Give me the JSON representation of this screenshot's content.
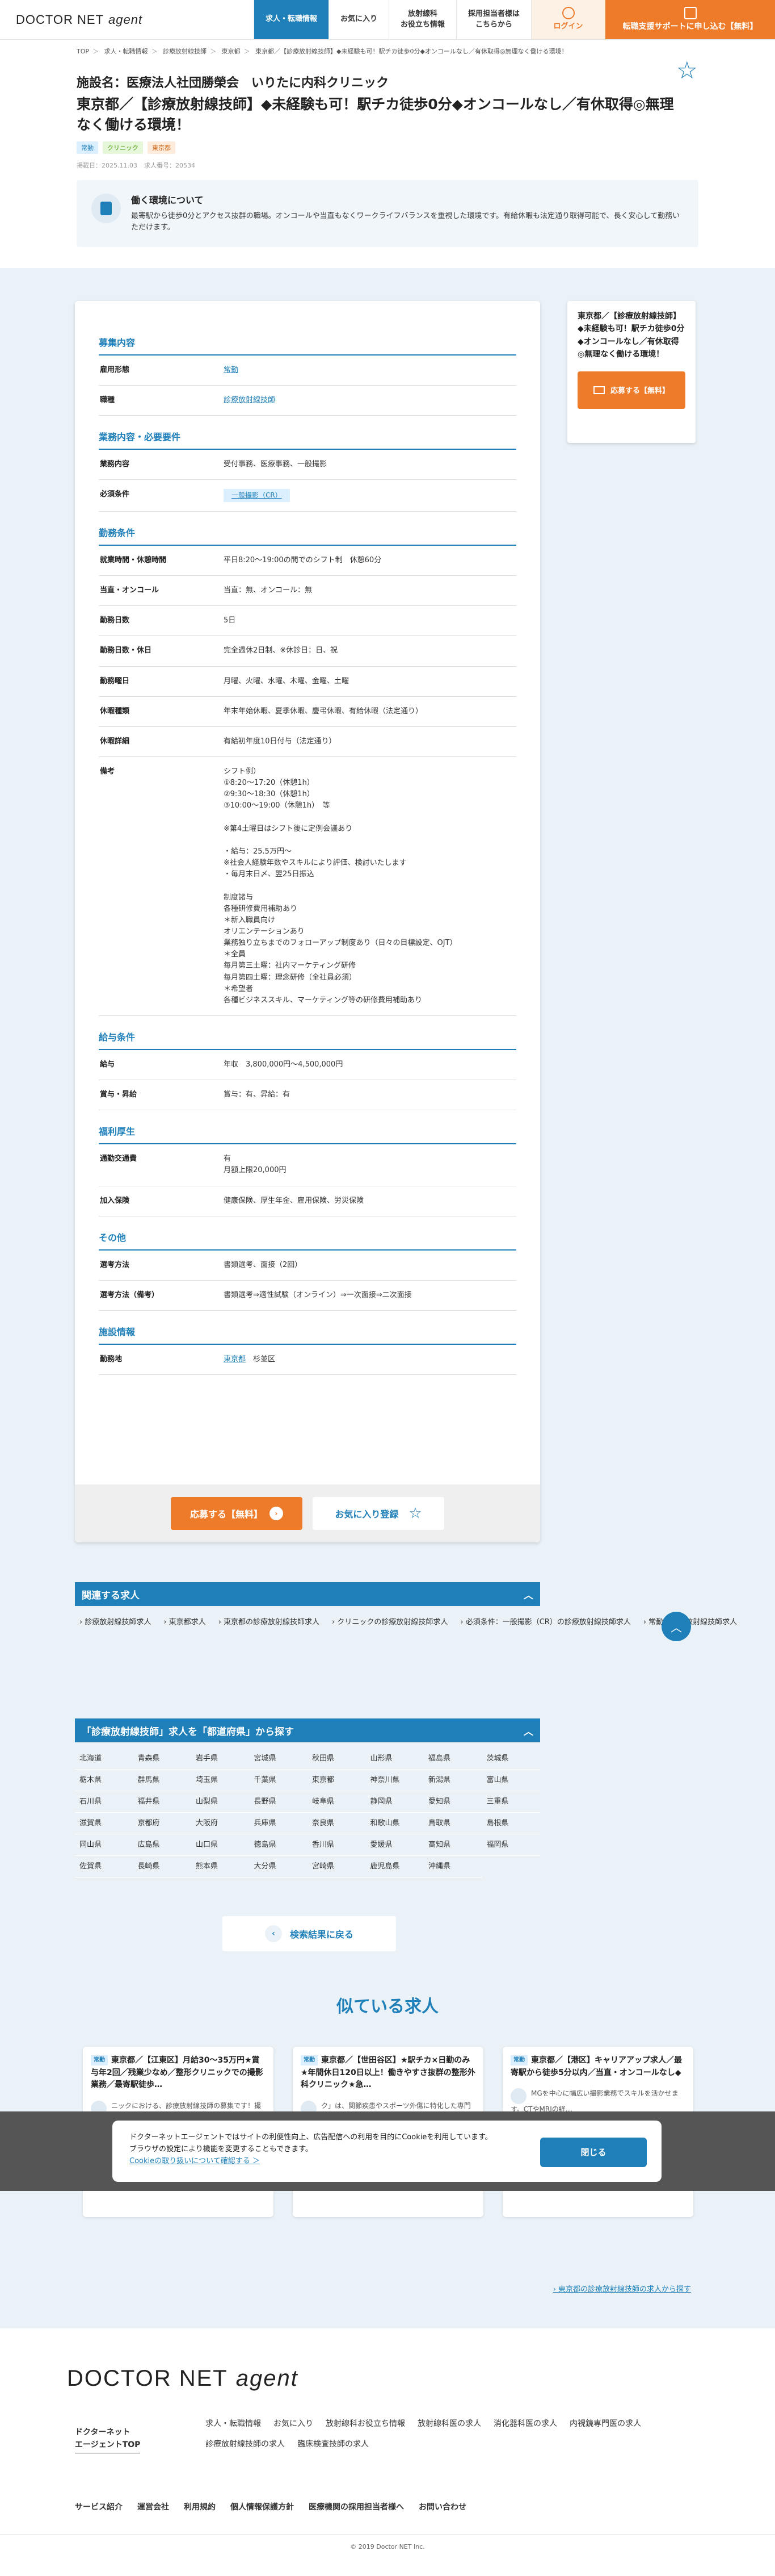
{
  "header": {
    "logo_main": "DOCTOR NET",
    "logo_sub": "agent",
    "nav": [
      "求人・転職情報",
      "お気に入り",
      "放射線科\nお役立ち情報",
      "採用担当者様は\nこちらから"
    ],
    "login": "ログイン",
    "cta": "転職支援サポートに申し込む【無料】"
  },
  "breadcrumb": [
    "TOP",
    "求人・転職情報",
    "診療放射線技師",
    "東京都",
    "東京都／【診療放射線技師】◆未経験も可！駅チカ徒歩0分◆オンコールなし／有休取得◎無理なく働ける環境！"
  ],
  "job": {
    "facility": "施設名：医療法人社団勝榮会　いりたに内科クリニック",
    "title": "東京都／【診療放射線技師】◆未経験も可！駅チカ徒歩0分◆オンコールなし／有休取得◎無理なく働ける環境！",
    "tags": [
      "常勤",
      "クリニック",
      "東京都"
    ],
    "posted": "掲載日：2025.11.03",
    "number": "求人番号：20534"
  },
  "env": {
    "title": "働く環境について",
    "text": "最寄駅から徒歩0分とアクセス抜群の職場。オンコールや当直もなくワークライフバランスを重視した環境です。有給休暇も法定通り取得可能で、長く安心して勤務いただけます。"
  },
  "sections": [
    {
      "title": "募集内容",
      "rows": [
        {
          "k": "雇用形態",
          "v": "常勤",
          "type": "link"
        },
        {
          "k": "職種",
          "v": "診療放射線技師",
          "type": "link"
        }
      ]
    },
    {
      "title": "業務内容・必要要件",
      "rows": [
        {
          "k": "業務内容",
          "v": "受付事務、医療事務、一般撮影"
        },
        {
          "k": "必須条件",
          "v": "一般撮影（CR）",
          "type": "chip"
        }
      ]
    },
    {
      "title": "勤務条件",
      "rows": [
        {
          "k": "就業時間・休憩時間",
          "v": "平日8:20〜19:00の間でのシフト制　休憩60分"
        },
        {
          "k": "当直・オンコール",
          "v": "当直：無、オンコール：無"
        },
        {
          "k": "勤務日数",
          "v": "5日"
        },
        {
          "k": "勤務日数・休日",
          "v": "完全週休2日制、※休診日：日、祝"
        },
        {
          "k": "勤務曜日",
          "v": "月曜、火曜、水曜、木曜、金曜、土曜"
        },
        {
          "k": "休暇種類",
          "v": "年末年始休暇、夏季休暇、慶弔休暇、有給休暇（法定通り）"
        },
        {
          "k": "休暇詳細",
          "v": "有給初年度10日付与（法定通り）"
        },
        {
          "k": "備考",
          "v": "シフト例）\n①8:20〜17:20（休憩1h）\n②9:30〜18:30（休憩1h）\n③10:00〜19:00（休憩1h）　等\n\n※第4土曜日はシフト後に定例会議あり\n\n・給与：25.5万円〜\n※社会人経験年数やスキルにより評価、検討いたします\n・毎月末日〆、翌25日振込\n\n制度諸与\n各種研修費用補助あり\n＊新入職員向け\nオリエンテーションあり\n業務独り立ちまでのフォローアップ制度あり（日々の目標設定、OJT）\n＊全員\n毎月第三土曜：社内マーケティング研修\n毎月第四土曜：理念研修（全社員必須）\n＊希望者\n各種ビジネススキル、マーケティング等の研修費用補助あり"
        }
      ]
    },
    {
      "title": "給与条件",
      "rows": [
        {
          "k": "給与",
          "v": "年収　3,800,000円〜4,500,000円"
        },
        {
          "k": "賞与・昇給",
          "v": "賞与：有、昇給：有"
        }
      ]
    },
    {
      "title": "福利厚生",
      "rows": [
        {
          "k": "通勤交通費",
          "v": "有\n月額上限20,000円"
        },
        {
          "k": "加入保険",
          "v": "健康保険、厚生年金、雇用保険、労災保険"
        }
      ]
    },
    {
      "title": "その他",
      "rows": [
        {
          "k": "選考方法",
          "v": "書類選考、面接（2回）"
        },
        {
          "k": "選考方法（備考）",
          "v": "書類選考⇒適性試験（オンライン）⇒一次面接⇒二次面接"
        }
      ]
    },
    {
      "title": "施設情報",
      "rows": [
        {
          "k": "勤務地",
          "v": "東京都　杉並区",
          "type": "loc"
        }
      ]
    }
  ],
  "card_footer": {
    "apply": "応募する【無料】",
    "fav": "お気に入り登録"
  },
  "side": {
    "title": "東京都／【診療放射線技師】◆未経験も可！駅チカ徒歩0分◆オンコールなし／有休取得◎無理なく働ける環境！",
    "button": "応募する【無料】"
  },
  "related": {
    "title": "関連する求人",
    "items": [
      "診療放射線技師求人",
      "東京都求人",
      "東京都の診療放射線技師求人",
      "クリニックの診療放射線技師求人",
      "必須条件：一般撮影（CR）の診療放射線技師求人",
      "常勤の診療放射線技師求人"
    ]
  },
  "prefs": {
    "title": "「診療放射線技師」求人を「都道府県」から探す",
    "items": [
      "北海道",
      "青森県",
      "岩手県",
      "宮城県",
      "秋田県",
      "山形県",
      "福島県",
      "茨城県",
      "栃木県",
      "群馬県",
      "埼玉県",
      "千葉県",
      "東京都",
      "神奈川県",
      "新潟県",
      "富山県",
      "石川県",
      "福井県",
      "山梨県",
      "長野県",
      "岐阜県",
      "静岡県",
      "愛知県",
      "三重県",
      "滋賀県",
      "京都府",
      "大阪府",
      "兵庫県",
      "奈良県",
      "和歌山県",
      "鳥取県",
      "島根県",
      "岡山県",
      "広島県",
      "山口県",
      "徳島県",
      "香川県",
      "愛媛県",
      "高知県",
      "福岡県",
      "佐賀県",
      "長崎県",
      "熊本県",
      "大分県",
      "宮崎県",
      "鹿児島県",
      "沖縄県"
    ]
  },
  "back": "検索結果に戻る",
  "similar": {
    "title": "似ている求人",
    "items": [
      {
        "title": "東京都／【江東区】月給30〜35万円★賞与年2回／残業少なめ／整形クリニックでの撮影業務／最寄駅徒歩…",
        "body1": "ニックにおける、診療放射線技師の募集です！撮影が1日約5…",
        "body2": "整形外科クリニックでの撮影業務をお任せ。診療補助や事務サポートにも携わるポジション。撮影件数は安定…"
      },
      {
        "title": "東京都／【世田谷区】★駅チカ×日勤のみ★年間休日120日以上！働きやすさ抜群の整形外科クリニック★急…",
        "body1": "ク」は、関節疾患やスポーツ外傷に特化した専門性の高い医療を提供してい…",
        "body2": "新規開院施設での撮影業務をお任せいたします。CT・MRI経験者を歓迎しております。勤務曜日や時間、日数は…"
      },
      {
        "title": "東京都／【港区】キャリアアップ求人／最寄駅から徒歩5分以内／当直・オンコールなし◆",
        "body1": "MGを中心に幅広い撮影業務でスキルを活かせます。CTやMRIの経…",
        "body2": ""
      }
    ]
  },
  "cookie": {
    "text1": "ドクターネットエージェントではサイトの利便性向上、広告配信への利用を目的にCookieを利用しています。",
    "text2": "ブラウザの設定により機能を変更することもできます。",
    "link": "Cookieの取り扱いについて確認する ＞",
    "close": "閉じる"
  },
  "more_link": "東京都の診療放射線技師の求人から探す",
  "footer": {
    "logo_main": "DOCTOR NET",
    "logo_sub": "agent",
    "top": "ドクターネット\nエージェントTOP",
    "links": [
      "求人・転職情報",
      "お気に入り",
      "放射線科お役立ち情報",
      "放射線科医の求人",
      "消化器科医の求人",
      "内視鏡専門医の求人",
      "診療放射線技師の求人",
      "臨床検査技師の求人"
    ],
    "bottom": [
      "サービス紹介",
      "運営会社",
      "利用規約",
      "個人情報保護方針",
      "医療機関の採用担当者様へ",
      "お問い合わせ"
    ],
    "copyright": "© 2019 Doctor NET Inc."
  }
}
